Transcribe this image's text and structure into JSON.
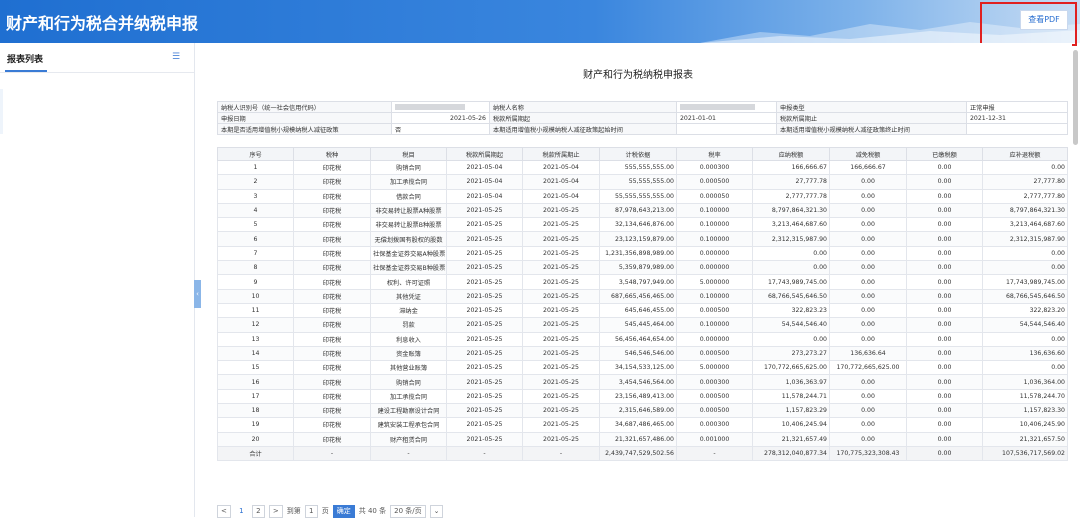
{
  "header": {
    "title": "财产和行为税合并纳税申报",
    "pdf_button": "查看PDF"
  },
  "sidebar": {
    "title": "报表列表"
  },
  "report": {
    "title": "财产和行为税纳税申报表",
    "info": {
      "taxpayer_id_label": "纳税人识别号（统一社会信用代码）",
      "taxpayer_name_label": "纳税人名称",
      "filing_type_label": "申报类型",
      "filing_type": "正常申报",
      "filing_date_label": "申报日期",
      "filing_date": "2021-05-26",
      "period_start_label": "税款所属期起",
      "period_start": "2021-01-01",
      "period_end_label": "税款所属期止",
      "period_end": "2021-12-31",
      "policy_label": "本期是否适用增值税小规模纳税人减征政策",
      "policy_value": "否",
      "policy_start_label": "本期适用增值税小规模纳税人减征政策起始时间",
      "policy_end_label": "本期适用增值税小规模纳税人减征政策终止时间"
    },
    "columns": [
      "序号",
      "税种",
      "税目",
      "税款所属期起",
      "税款所属期止",
      "计税依据",
      "税率",
      "应纳税额",
      "减免税额",
      "已缴税额",
      "应补退税额"
    ],
    "rows": [
      [
        "1",
        "印花税",
        "购销合同",
        "2021-05-04",
        "2021-05-04",
        "555,555,555.00",
        "0.000300",
        "166,666.67",
        "166,666.67",
        "0.00",
        "0.00"
      ],
      [
        "2",
        "印花税",
        "加工承揽合同",
        "2021-05-04",
        "2021-05-04",
        "55,555,555.00",
        "0.000500",
        "27,777.78",
        "0.00",
        "0.00",
        "27,777.80"
      ],
      [
        "3",
        "印花税",
        "借款合同",
        "2021-05-04",
        "2021-05-04",
        "55,555,555,555.00",
        "0.000050",
        "2,777,777.78",
        "0.00",
        "0.00",
        "2,777,777.80"
      ],
      [
        "4",
        "印花税",
        "非交易转让股票A种股票",
        "2021-05-25",
        "2021-05-25",
        "87,978,643,213.00",
        "0.100000",
        "8,797,864,321.30",
        "0.00",
        "0.00",
        "8,797,864,321.30"
      ],
      [
        "5",
        "印花税",
        "非交易转让股票B种股票",
        "2021-05-25",
        "2021-05-25",
        "32,134,646,876.00",
        "0.100000",
        "3,213,464,687.60",
        "0.00",
        "0.00",
        "3,213,464,687.60"
      ],
      [
        "6",
        "印花税",
        "无偿划拨国有股权的股数",
        "2021-05-25",
        "2021-05-25",
        "23,123,159,879.00",
        "0.100000",
        "2,312,315,987.90",
        "0.00",
        "0.00",
        "2,312,315,987.90"
      ],
      [
        "7",
        "印花税",
        "社保基金证券交易A种股票",
        "2021-05-25",
        "2021-05-25",
        "1,231,356,898,989.00",
        "0.000000",
        "0.00",
        "0.00",
        "0.00",
        "0.00"
      ],
      [
        "8",
        "印花税",
        "社保基金证券交易B种股票",
        "2021-05-25",
        "2021-05-25",
        "5,359,879,989.00",
        "0.000000",
        "0.00",
        "0.00",
        "0.00",
        "0.00"
      ],
      [
        "9",
        "印花税",
        "权利、许可证照",
        "2021-05-25",
        "2021-05-25",
        "3,548,797,949.00",
        "5.000000",
        "17,743,989,745.00",
        "0.00",
        "0.00",
        "17,743,989,745.00"
      ],
      [
        "10",
        "印花税",
        "其他凭证",
        "2021-05-25",
        "2021-05-25",
        "687,665,456,465.00",
        "0.100000",
        "68,766,545,646.50",
        "0.00",
        "0.00",
        "68,766,545,646.50"
      ],
      [
        "11",
        "印花税",
        "滞纳金",
        "2021-05-25",
        "2021-05-25",
        "645,646,455.00",
        "0.000500",
        "322,823.23",
        "0.00",
        "0.00",
        "322,823.20"
      ],
      [
        "12",
        "印花税",
        "罚款",
        "2021-05-25",
        "2021-05-25",
        "545,445,464.00",
        "0.100000",
        "54,544,546.40",
        "0.00",
        "0.00",
        "54,544,546.40"
      ],
      [
        "13",
        "印花税",
        "利息收入",
        "2021-05-25",
        "2021-05-25",
        "56,456,464,654.00",
        "0.000000",
        "0.00",
        "0.00",
        "0.00",
        "0.00"
      ],
      [
        "14",
        "印花税",
        "资金账簿",
        "2021-05-25",
        "2021-05-25",
        "546,546,546.00",
        "0.000500",
        "273,273.27",
        "136,636.64",
        "0.00",
        "136,636.60"
      ],
      [
        "15",
        "印花税",
        "其他营业账簿",
        "2021-05-25",
        "2021-05-25",
        "34,154,533,125.00",
        "5.000000",
        "170,772,665,625.00",
        "170,772,665,625.00",
        "0.00",
        "0.00"
      ],
      [
        "16",
        "印花税",
        "购销合同",
        "2021-05-25",
        "2021-05-25",
        "3,454,546,564.00",
        "0.000300",
        "1,036,363.97",
        "0.00",
        "0.00",
        "1,036,364.00"
      ],
      [
        "17",
        "印花税",
        "加工承揽合同",
        "2021-05-25",
        "2021-05-25",
        "23,156,489,413.00",
        "0.000500",
        "11,578,244.71",
        "0.00",
        "0.00",
        "11,578,244.70"
      ],
      [
        "18",
        "印花税",
        "建设工程勘察设计合同",
        "2021-05-25",
        "2021-05-25",
        "2,315,646,589.00",
        "0.000500",
        "1,157,823.29",
        "0.00",
        "0.00",
        "1,157,823.30"
      ],
      [
        "19",
        "印花税",
        "建筑安装工程承包合同",
        "2021-05-25",
        "2021-05-25",
        "34,687,486,465.00",
        "0.000300",
        "10,406,245.94",
        "0.00",
        "0.00",
        "10,406,245.90"
      ],
      [
        "20",
        "印花税",
        "财产租赁合同",
        "2021-05-25",
        "2021-05-25",
        "21,321,657,486.00",
        "0.001000",
        "21,321,657.49",
        "0.00",
        "0.00",
        "21,321,657.50"
      ]
    ],
    "total": [
      "合计",
      "-",
      "-",
      "-",
      "-",
      "2,439,747,529,502.56",
      "-",
      "278,312,040,877.34",
      "170,775,323,308.43",
      "0.00",
      "107,536,717,569.02"
    ]
  },
  "pager": {
    "prev": "<",
    "page1": "1",
    "page2": "2",
    "next": ">",
    "goto_label": "到第",
    "page_input": "1",
    "page_unit": "页",
    "confirm": "确定",
    "total": "共 40 条",
    "page_size": "20 条/页"
  }
}
